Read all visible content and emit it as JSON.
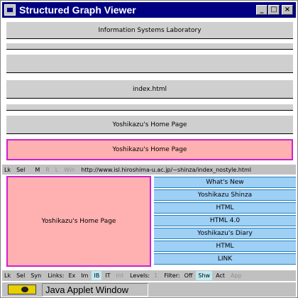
{
  "window": {
    "title": "Structured Graph Viewer",
    "controls": {
      "minimize": "_",
      "maximize": "□",
      "close": "×"
    }
  },
  "graph": {
    "bars": [
      {
        "label": "Information Systems Laboratory",
        "selected": false
      },
      {
        "label": "",
        "selected": false
      },
      {
        "label": "",
        "selected": false
      },
      {
        "label": "index.html",
        "selected": false
      },
      {
        "label": "",
        "selected": false
      },
      {
        "label": "Yoshikazu's Home Page",
        "selected": false
      },
      {
        "label": "Yoshikazu's Home Page",
        "selected": true
      }
    ]
  },
  "status_row": {
    "buttons": [
      "Lk",
      "Sel",
      "M",
      "R",
      "L",
      "Win"
    ],
    "url": "http://www.isl.hiroshima-u.ac.jp/~shinza/index_nostyle.html"
  },
  "detail": {
    "page_title": "Yoshikazu's Home Page",
    "links": [
      "What's New",
      "Yoshikazu Shinza",
      "HTML",
      "HTML 4.0",
      "Yoshikazu's Diary",
      "HTML",
      "LINK"
    ]
  },
  "toolbar": {
    "lk": "Lk",
    "sel": "Sel",
    "syn": "Syn",
    "links_label": "Links:",
    "ex": "Ex",
    "im": "Im",
    "ib": "IB",
    "it": "IT",
    "int": "Int",
    "levels_label": "Levels:",
    "level_value": "1",
    "filter_label": "Filter:",
    "off": "Off",
    "shw": "Shw",
    "act": "Act",
    "app": "App"
  },
  "statusbar": {
    "text": "Java Applet Window"
  },
  "colors": {
    "titlebar": "#000080",
    "selected": "#ffb0b0",
    "selected_border": "#d020d0",
    "link": "#9ecff5",
    "bar": "#cfcfcf"
  }
}
